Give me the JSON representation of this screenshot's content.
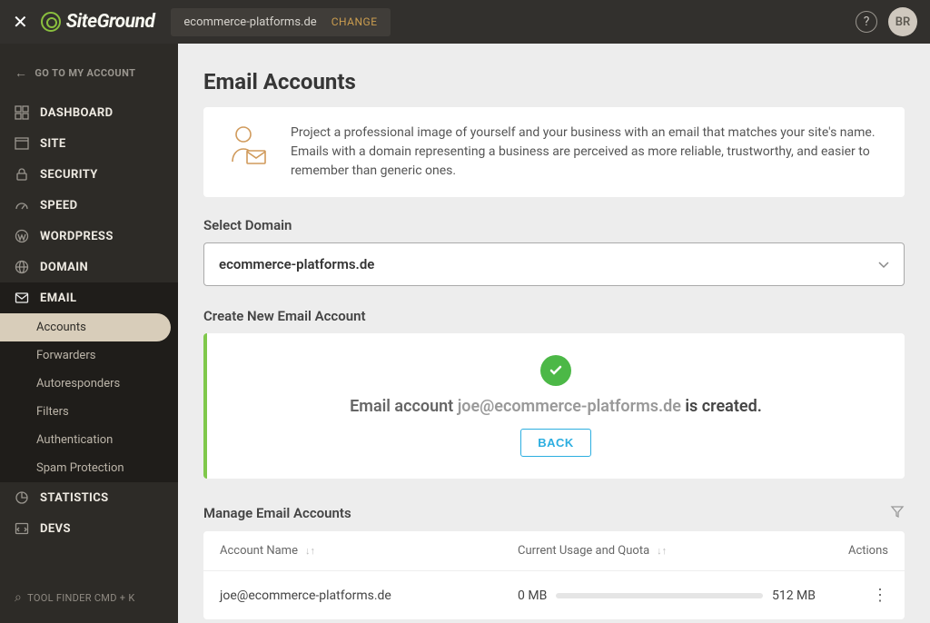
{
  "topbar": {
    "logo_text": "SiteGround",
    "domain": "ecommerce-platforms.de",
    "change_label": "CHANGE",
    "avatar_initials": "BR"
  },
  "sidebar": {
    "back_label": "GO TO MY ACCOUNT",
    "items": [
      {
        "label": "DASHBOARD"
      },
      {
        "label": "SITE"
      },
      {
        "label": "SECURITY"
      },
      {
        "label": "SPEED"
      },
      {
        "label": "WORDPRESS"
      },
      {
        "label": "DOMAIN"
      },
      {
        "label": "EMAIL"
      },
      {
        "label": "STATISTICS"
      },
      {
        "label": "DEVS"
      }
    ],
    "email_sub": [
      {
        "label": "Accounts"
      },
      {
        "label": "Forwarders"
      },
      {
        "label": "Autoresponders"
      },
      {
        "label": "Filters"
      },
      {
        "label": "Authentication"
      },
      {
        "label": "Spam Protection"
      }
    ],
    "tool_finder": "TOOL FINDER CMD + K"
  },
  "page": {
    "title": "Email Accounts",
    "intro": "Project a professional image of yourself and your business with an email that matches your site's name. Emails with a domain representing a business are perceived as more reliable, trustworthy, and easier to remember than generic ones.",
    "select_label": "Select Domain",
    "selected_domain": "ecommerce-platforms.de",
    "create_label": "Create New Email Account",
    "success_prefix": "Email account ",
    "success_email": "joe@ecommerce-platforms.de",
    "success_suffix": " is created.",
    "back_button": "BACK",
    "manage_label": "Manage Email Accounts",
    "columns": {
      "name": "Account Name",
      "quota": "Current Usage and Quota",
      "actions": "Actions"
    },
    "rows": [
      {
        "name": "joe@ecommerce-platforms.de",
        "usage": "0 MB",
        "quota": "512 MB"
      }
    ]
  }
}
